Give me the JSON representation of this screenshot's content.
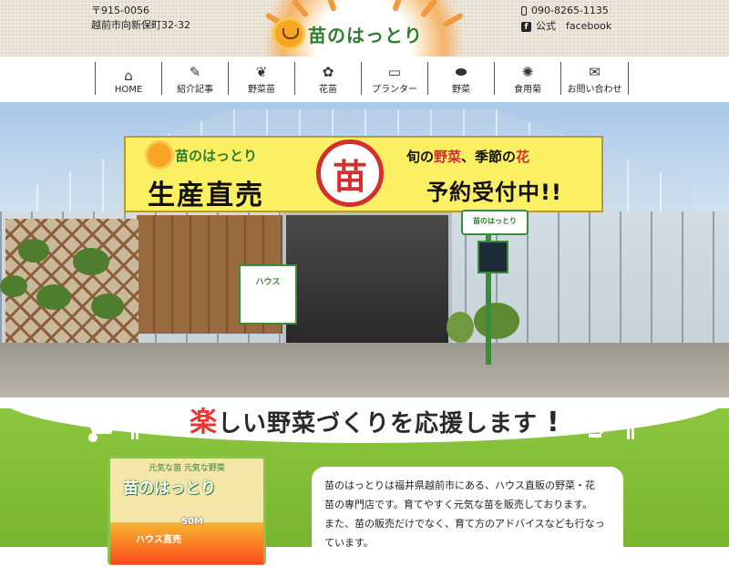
{
  "header": {
    "postal": "〒915-0056",
    "address": "越前市向新保町32-32",
    "phone": "090-8265-1135",
    "facebook_prefix": "公式",
    "facebook_label": "facebook",
    "logo_text": "苗のはっとり"
  },
  "nav": {
    "items": [
      {
        "label": "HOME",
        "icon": "home-icon"
      },
      {
        "label": "紹介記事",
        "icon": "pencil-icon"
      },
      {
        "label": "野菜苗",
        "icon": "sprout-icon"
      },
      {
        "label": "花苗",
        "icon": "flower-icon"
      },
      {
        "label": "プランター",
        "icon": "planter-icon"
      },
      {
        "label": "野菜",
        "icon": "eggplant-icon"
      },
      {
        "label": "食用菊",
        "icon": "chrysanthemum-icon"
      },
      {
        "label": "お問い合わせ",
        "icon": "mail-icon"
      }
    ]
  },
  "hero": {
    "banner_logo": "苗のはっとり",
    "banner_big": "生産直売",
    "banner_circle": "苗",
    "banner_right_1a": "旬の",
    "banner_right_1b": "野菜",
    "banner_right_1c": "、季節の",
    "banner_right_1d": "花",
    "banner_right_2": "予約受付中!!",
    "post_sign": "苗のはっとり",
    "small_sign": "ハウス"
  },
  "lower": {
    "tagline_red": "楽",
    "tagline_rest": "しい野菜づくりを応援します",
    "tagline_excl": "!",
    "package_top": "元気な苗 元気な野菜",
    "package_title": "苗のはっとり",
    "package_size": "50M",
    "package_label": "ハウス直売",
    "description": [
      "苗のはっとりは福井県越前市にある、ハウス直販の野菜・花",
      "苗の専門店です。育てやすく元気な苗を販売しております。",
      "また、苗の販売だけでなく、育て方のアドバイスなども行なっ",
      "ています。"
    ]
  },
  "colors": {
    "accent_green": "#2e7d32",
    "banner_yellow": "#fbef63",
    "accent_red": "#d32f2f",
    "grass": "#8cc63f"
  }
}
